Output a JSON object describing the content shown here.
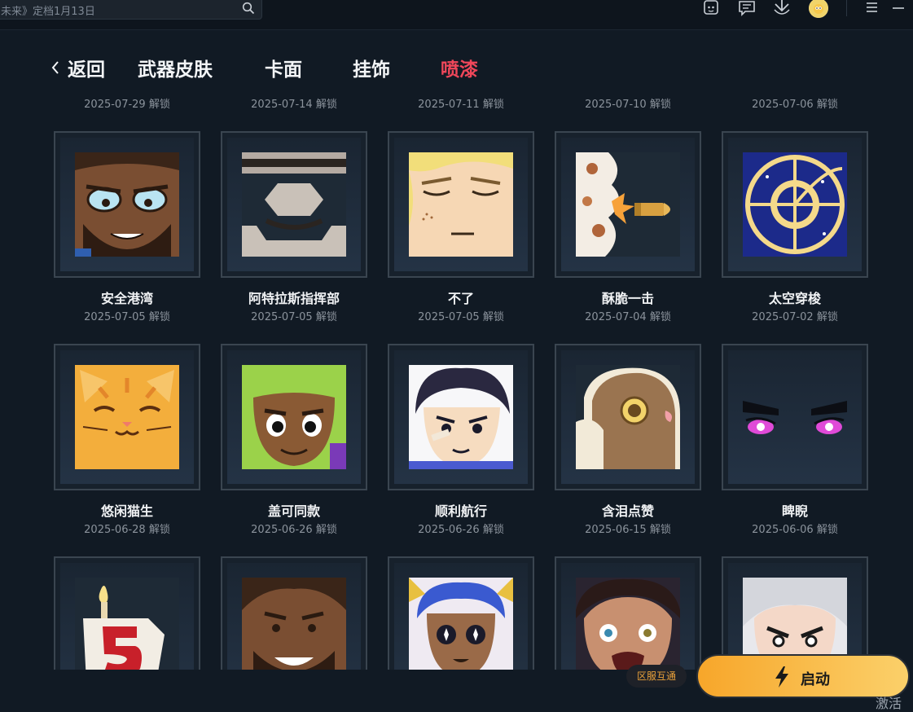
{
  "topbar": {
    "search_text": "未来》定档1月13日",
    "icons": [
      "search-icon",
      "bot-icon",
      "chat-icon",
      "download-icon",
      "avatar",
      "menu-icon",
      "minimize-icon"
    ]
  },
  "nav": {
    "back_label": "返回",
    "tabs": [
      "武器皮肤",
      "卡面",
      "挂饰",
      "喷漆"
    ],
    "active_tab": "喷漆",
    "active_color": "#f0475a"
  },
  "previous_row_dates": [
    "2025-07-29 解锁",
    "2025-07-14 解锁",
    "2025-07-11 解锁",
    "2025-07-10 解锁",
    "2025-07-06 解锁"
  ],
  "sprays": [
    {
      "name": "安全港湾",
      "date": "2025-07-05 解锁"
    },
    {
      "name": "阿特拉斯指挥部",
      "date": "2025-07-05 解锁"
    },
    {
      "name": "不了",
      "date": "2025-07-05 解锁"
    },
    {
      "name": "酥脆一击",
      "date": "2025-07-04 解锁"
    },
    {
      "name": "太空穿梭",
      "date": "2025-07-02 解锁"
    },
    {
      "name": "悠闲猫生",
      "date": "2025-06-28 解锁"
    },
    {
      "name": "盖可同款",
      "date": "2025-06-26 解锁"
    },
    {
      "name": "顺利航行",
      "date": "2025-06-26 解锁"
    },
    {
      "name": "含泪点赞",
      "date": "2025-06-15 解锁"
    },
    {
      "name": "睥睨",
      "date": "2025-06-06 解锁"
    }
  ],
  "bottom": {
    "region_label": "区服互通",
    "launch_label": "启动",
    "activate_text": "激活",
    "accent_color": "#f7a62a"
  }
}
